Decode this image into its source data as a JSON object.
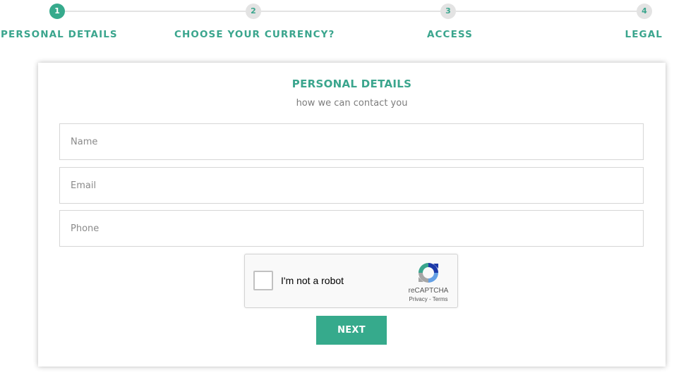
{
  "stepper": {
    "steps": [
      {
        "number": "1",
        "label": "PERSONAL DETAILS",
        "active": true
      },
      {
        "number": "2",
        "label": "CHOOSE YOUR CURRENCY?",
        "active": false
      },
      {
        "number": "3",
        "label": "ACCESS",
        "active": false
      },
      {
        "number": "4",
        "label": "LEGAL",
        "active": false
      }
    ]
  },
  "form": {
    "title": "PERSONAL DETAILS",
    "subtitle": "how we can contact you",
    "fields": {
      "name": {
        "placeholder": "Name",
        "value": ""
      },
      "email": {
        "placeholder": "Email",
        "value": ""
      },
      "phone": {
        "placeholder": "Phone",
        "value": ""
      }
    },
    "next_label": "NEXT"
  },
  "recaptcha": {
    "label": "I'm not a robot",
    "brand": "reCAPTCHA",
    "privacy": "Privacy",
    "separator": " - ",
    "terms": "Terms",
    "checked": false,
    "logo_icon": "recaptcha-logo-icon"
  },
  "colors": {
    "accent": "#36aa8c",
    "accent_text": "#3aa58d",
    "inactive_step": "#e3e3e3",
    "subtitle": "#7c7c7c",
    "field_border": "#d6d6d6"
  }
}
